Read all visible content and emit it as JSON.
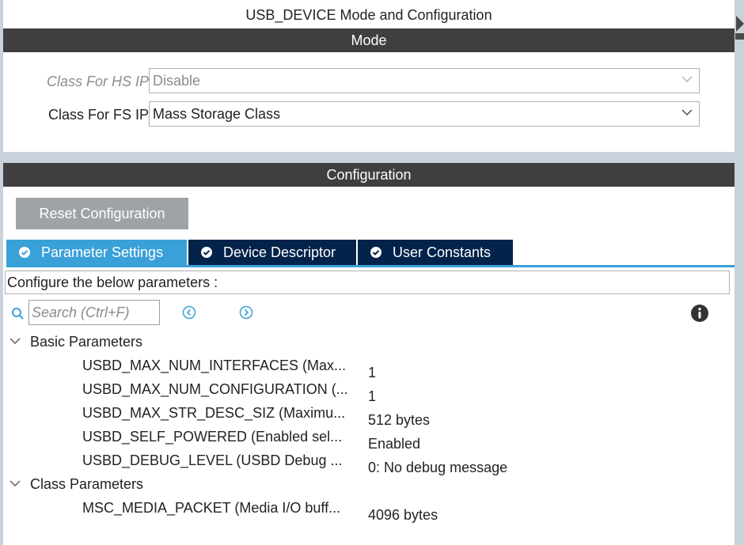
{
  "title": "USB_DEVICE Mode and Configuration",
  "mode": {
    "header": "Mode",
    "hs": {
      "label": "Class For HS IP",
      "value": "Disable"
    },
    "fs": {
      "label": "Class For FS IP",
      "value": "Mass Storage Class"
    }
  },
  "config": {
    "header": "Configuration",
    "reset_label": "Reset Configuration",
    "tabs": [
      "Parameter Settings",
      "Device Descriptor",
      "User Constants"
    ],
    "description": "Configure the below parameters :",
    "search_placeholder": "Search (Ctrl+F)",
    "groups": [
      {
        "name": "Basic Parameters",
        "params": [
          {
            "name": "USBD_MAX_NUM_INTERFACES (Max...",
            "value": "1"
          },
          {
            "name": "USBD_MAX_NUM_CONFIGURATION (...",
            "value": "1"
          },
          {
            "name": "USBD_MAX_STR_DESC_SIZ (Maximu...",
            "value": "512 bytes"
          },
          {
            "name": "USBD_SELF_POWERED (Enabled sel...",
            "value": "Enabled"
          },
          {
            "name": "USBD_DEBUG_LEVEL (USBD Debug ...",
            "value": "0: No debug message"
          }
        ]
      },
      {
        "name": "Class Parameters",
        "params": [
          {
            "name": "MSC_MEDIA_PACKET (Media I/O buff...",
            "value": "4096 bytes"
          }
        ]
      }
    ]
  },
  "colors": {
    "header_bg": "#3f3f3f",
    "tab_active": "#3aa0d8",
    "tab_inactive": "#03234b",
    "button_bg": "#9ea3a8"
  },
  "icons": [
    "chevron-down-icon",
    "check-circle-icon",
    "search-icon",
    "previous-icon",
    "next-icon",
    "info-icon",
    "collapse-arrow-icon"
  ]
}
